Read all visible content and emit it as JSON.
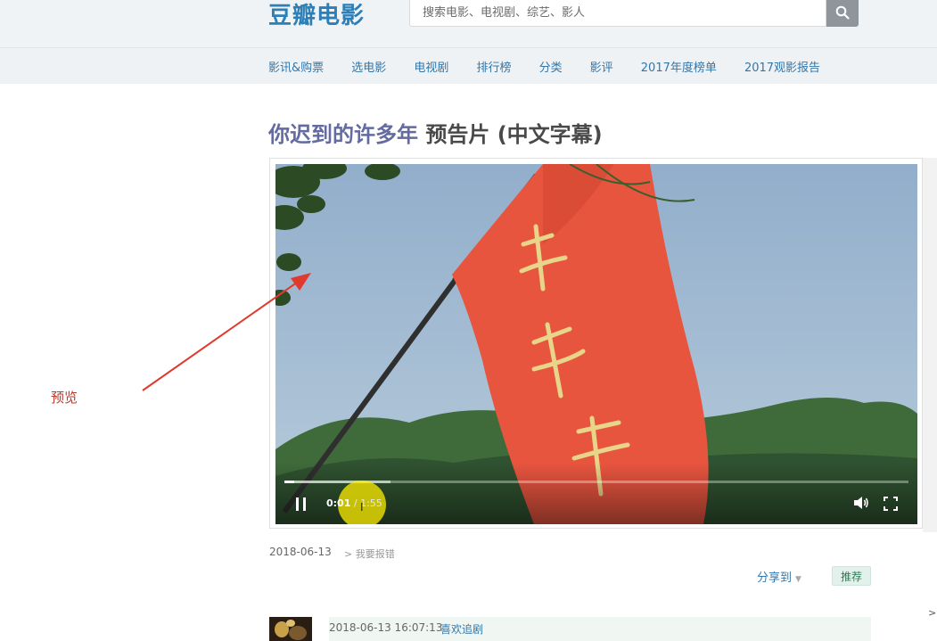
{
  "header": {
    "logo": "豆瓣电影",
    "search_placeholder": "搜索电影、电视剧、综艺、影人"
  },
  "nav": {
    "items": [
      "影讯&购票",
      "选电影",
      "电视剧",
      "排行榜",
      "分类",
      "影评",
      "2017年度榜单",
      "2017观影报告"
    ]
  },
  "page": {
    "title_movie": "你迟到的许多年",
    "title_rest": " 预告片 (中文字幕)"
  },
  "player": {
    "current_time": "0:01",
    "separator": " / ",
    "total_time": "1:55",
    "progress_fraction": 0.015,
    "buffered_fraction": 0.17
  },
  "annotation": {
    "label": "预览",
    "color": "#e03a2e"
  },
  "meta": {
    "date": "2018-06-13",
    "report": "> 我要报错",
    "share": "分享到",
    "recommend": "推荐"
  },
  "comments": [
    {
      "time": "2018-06-13 16:07:13",
      "user": "喜欢追剧"
    }
  ],
  "edge_arrow": ">"
}
